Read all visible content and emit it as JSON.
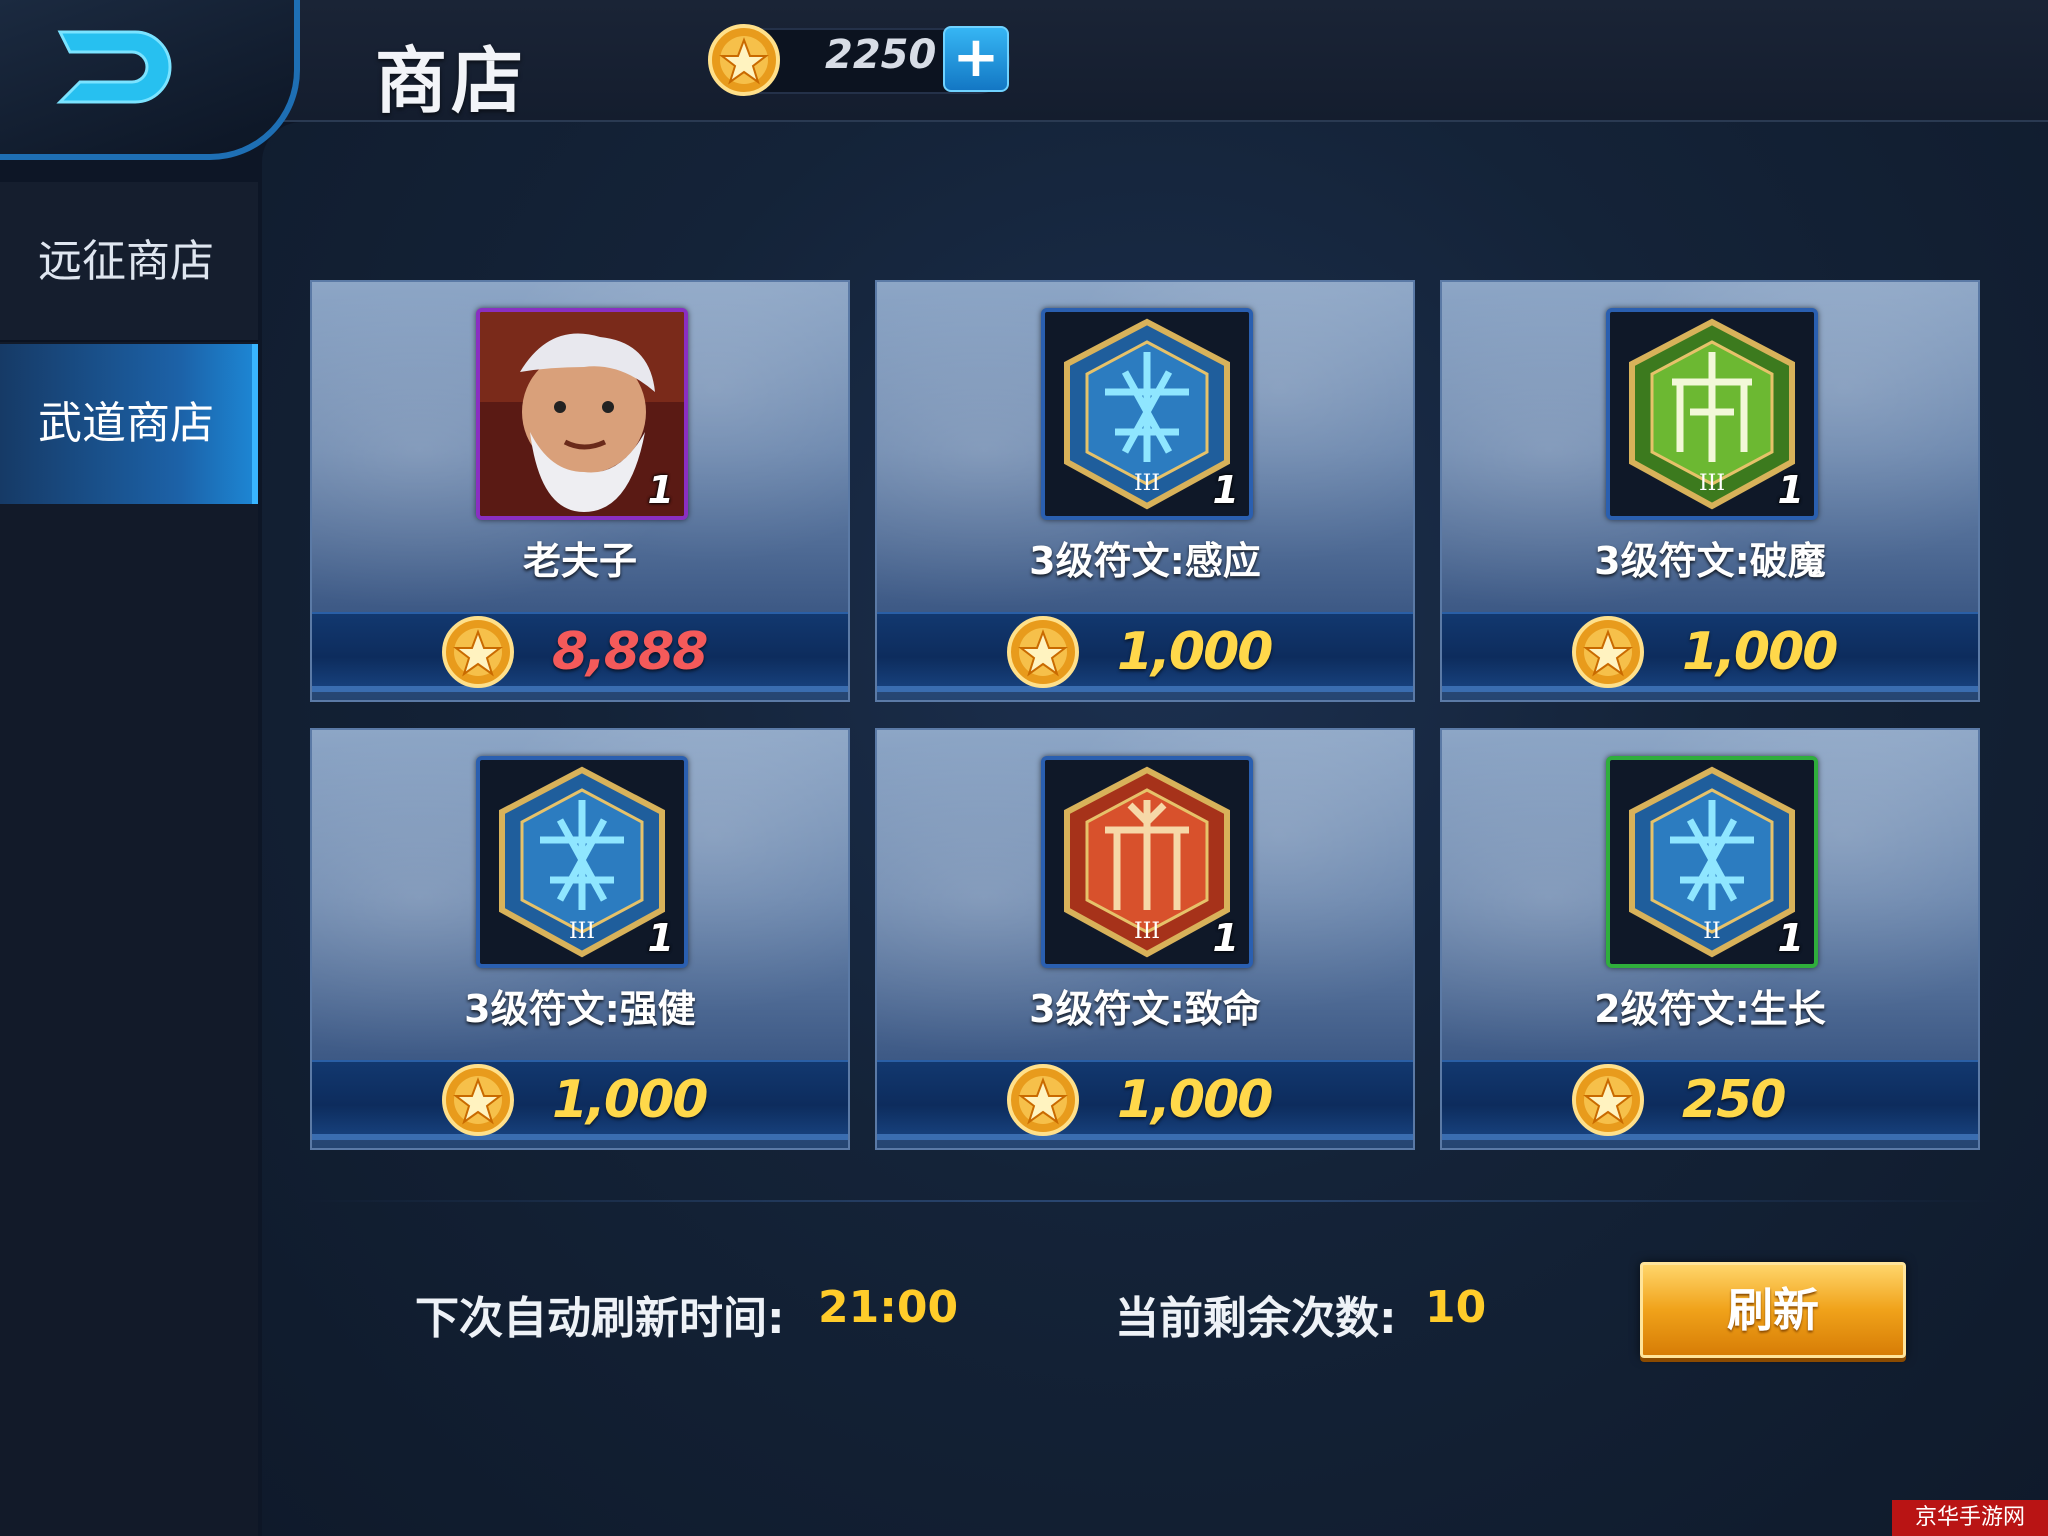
{
  "header": {
    "title": "商店",
    "currency_amount": "2250",
    "plus_label": "+",
    "back_icon": "back-arrow-icon",
    "coin_icon": "coin-icon"
  },
  "sidebar": {
    "items": [
      {
        "label": "远征商店",
        "active": false
      },
      {
        "label": "武道商店",
        "active": true
      }
    ]
  },
  "shop": {
    "items": [
      {
        "name": "老夫子",
        "quantity": "1",
        "price": "8,888",
        "price_color": "#f45a5a",
        "icon": "hero-portrait-icon",
        "frame": "purple"
      },
      {
        "name": "3级符文:感应",
        "quantity": "1",
        "price": "1,000",
        "price_color": "#ffd84a",
        "icon": "blue-rune-icon",
        "frame": "blue"
      },
      {
        "name": "3级符文:破魔",
        "quantity": "1",
        "price": "1,000",
        "price_color": "#ffd84a",
        "icon": "green-rune-icon",
        "frame": "blue"
      },
      {
        "name": "3级符文:强健",
        "quantity": "1",
        "price": "1,000",
        "price_color": "#ffd84a",
        "icon": "blue-rune-icon",
        "frame": "blue"
      },
      {
        "name": "3级符文:致命",
        "quantity": "1",
        "price": "1,000",
        "price_color": "#ffd84a",
        "icon": "red-rune-icon",
        "frame": "blue"
      },
      {
        "name": "2级符文:生长",
        "quantity": "1",
        "price": "250",
        "price_color": "#ffd84a",
        "icon": "blue-rune-icon",
        "frame": "green"
      }
    ]
  },
  "footer": {
    "refresh_time_label": "下次自动刷新时间:",
    "refresh_time_value": "21:00",
    "remaining_label": "当前剩余次数:",
    "remaining_value": "10",
    "refresh_button": "刷新"
  },
  "watermark": "京华手游网",
  "colors": {
    "accent": "#1d88d6",
    "gold": "#ffd84a",
    "red_price": "#f45a5a",
    "button_gold": "#f0a21a"
  }
}
